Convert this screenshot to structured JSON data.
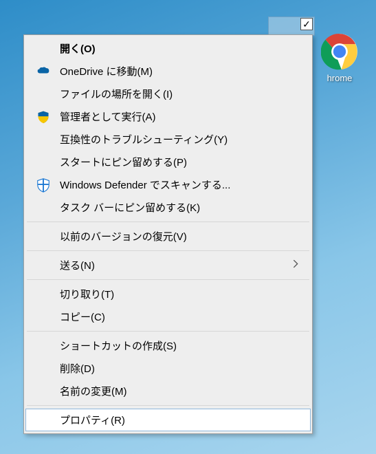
{
  "desktop": {
    "chrome_label": "hrome",
    "selected_checked": "✓"
  },
  "menu": {
    "open": "開く(O)",
    "onedrive_move": "OneDrive に移動(M)",
    "open_file_location": "ファイルの場所を開く(I)",
    "run_as_admin": "管理者として実行(A)",
    "troubleshoot_compat": "互換性のトラブルシューティング(Y)",
    "pin_to_start": "スタートにピン留めする(P)",
    "defender_scan": "Windows Defender でスキャンする...",
    "pin_to_taskbar": "タスク バーにピン留めする(K)",
    "restore_previous": "以前のバージョンの復元(V)",
    "send_to": "送る(N)",
    "cut": "切り取り(T)",
    "copy": "コピー(C)",
    "create_shortcut": "ショートカットの作成(S)",
    "delete": "削除(D)",
    "rename": "名前の変更(M)",
    "properties": "プロパティ(R)"
  }
}
